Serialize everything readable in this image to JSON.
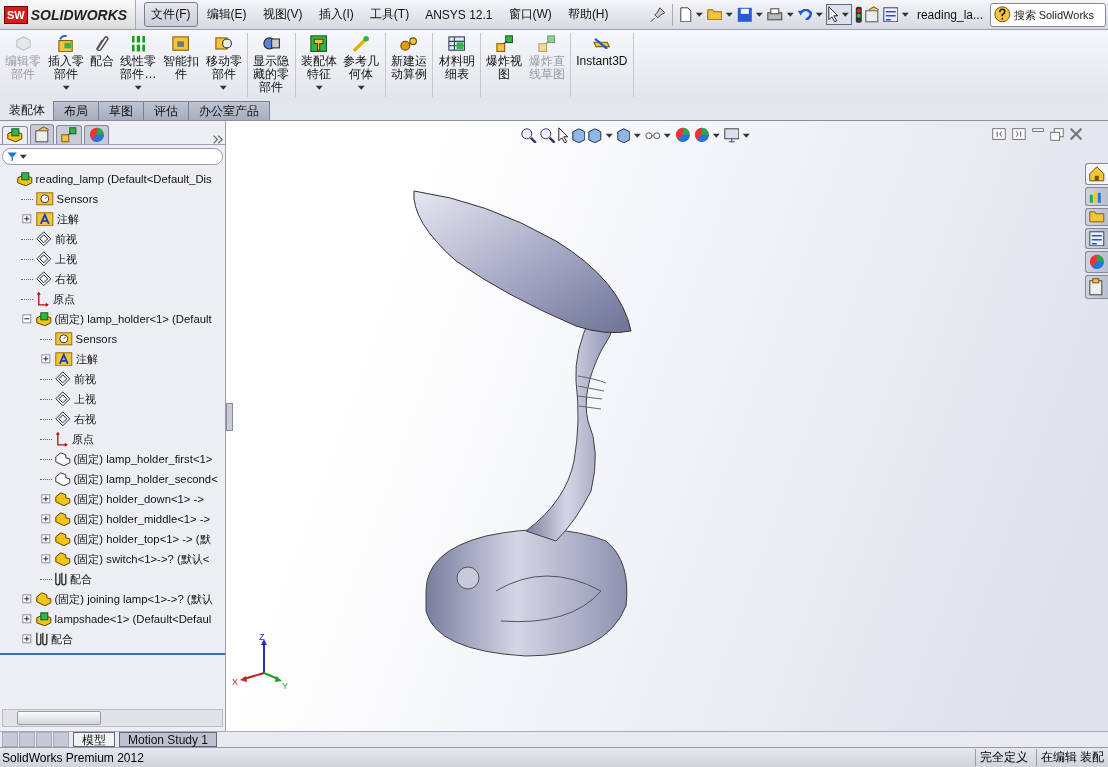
{
  "app": {
    "logo_mark": "SW",
    "logo_text": "SOLIDWORKS"
  },
  "menu": [
    {
      "label": "文件(F)",
      "selected": true
    },
    {
      "label": "编辑(E)",
      "selected": false
    },
    {
      "label": "视图(V)",
      "selected": false
    },
    {
      "label": "插入(I)",
      "selected": false
    },
    {
      "label": "工具(T)",
      "selected": false
    },
    {
      "label": "ANSYS 12.1",
      "selected": false
    },
    {
      "label": "窗口(W)",
      "selected": false
    },
    {
      "label": "帮助(H)",
      "selected": false
    }
  ],
  "document_name": "reading_la...",
  "search": {
    "placeholder": "搜索 SolidWorks"
  },
  "commands": [
    {
      "label": "编辑零部件",
      "disabled": true,
      "dropdown": false
    },
    {
      "label": "插入零部件",
      "disabled": false,
      "dropdown": true
    },
    {
      "label": "配合",
      "disabled": false,
      "dropdown": false
    },
    {
      "label": "线性零部件…",
      "disabled": false,
      "dropdown": true
    },
    {
      "label": "智能扣件",
      "disabled": false,
      "dropdown": false
    },
    {
      "label": "移动零部件",
      "disabled": false,
      "dropdown": true
    },
    {
      "label": "显示隐藏的零部件",
      "disabled": false,
      "dropdown": false
    },
    {
      "label": "装配体特征",
      "disabled": false,
      "dropdown": true
    },
    {
      "label": "参考几何体",
      "disabled": false,
      "dropdown": true
    },
    {
      "label": "新建运动算例",
      "disabled": false,
      "dropdown": false
    },
    {
      "label": "材料明细表",
      "disabled": false,
      "dropdown": false
    },
    {
      "label": "爆炸视图",
      "disabled": false,
      "dropdown": false
    },
    {
      "label": "爆炸直线草图",
      "disabled": true,
      "dropdown": false
    },
    {
      "label": "Instant3D",
      "disabled": false,
      "dropdown": false
    }
  ],
  "tabs": [
    {
      "label": "装配体",
      "selected": true
    },
    {
      "label": "布局",
      "selected": false
    },
    {
      "label": "草图",
      "selected": false
    },
    {
      "label": "评估",
      "selected": false
    },
    {
      "label": "办公室产品",
      "selected": false
    }
  ],
  "tree": [
    {
      "kind": "assembly",
      "label": "reading_lamp  (Default<Default_Dis",
      "children": [
        {
          "kind": "sensors",
          "label": "Sensors"
        },
        {
          "kind": "annotations",
          "label": "注解",
          "expanded": false
        },
        {
          "kind": "plane",
          "label": "前视"
        },
        {
          "kind": "plane",
          "label": "上视"
        },
        {
          "kind": "plane",
          "label": "右视"
        },
        {
          "kind": "origin",
          "label": "原点"
        },
        {
          "kind": "assembly",
          "label": "(固定) lamp_holder<1> (Default",
          "expanded": true,
          "children": [
            {
              "kind": "sensors",
              "label": "Sensors"
            },
            {
              "kind": "annotations",
              "label": "注解",
              "expanded": false
            },
            {
              "kind": "plane",
              "label": "前视"
            },
            {
              "kind": "plane",
              "label": "上视"
            },
            {
              "kind": "plane",
              "label": "右视"
            },
            {
              "kind": "origin",
              "label": "原点"
            },
            {
              "kind": "part-outline",
              "label": "(固定) lamp_holder_first<1>"
            },
            {
              "kind": "part-outline",
              "label": "(固定) lamp_holder_second<"
            },
            {
              "kind": "part",
              "label": "(固定) holder_down<1> ->",
              "expanded": false
            },
            {
              "kind": "part",
              "label": "(固定) holder_middle<1> ->",
              "expanded": false
            },
            {
              "kind": "part",
              "label": "(固定) holder_top<1> -> (默",
              "expanded": false
            },
            {
              "kind": "part",
              "label": "(固定) switch<1>->? (默认<",
              "expanded": false
            },
            {
              "kind": "mates",
              "label": "配合"
            }
          ]
        },
        {
          "kind": "part",
          "label": "(固定) joining lamp<1>->? (默认",
          "expanded": false
        },
        {
          "kind": "assembly",
          "label": "lampshade<1> (Default<Defaul",
          "expanded": false
        },
        {
          "kind": "mates",
          "label": "配合",
          "expanded": false
        }
      ]
    }
  ],
  "triad": {
    "x": "X",
    "y": "Y",
    "z": "Z"
  },
  "bottom_tabs": [
    {
      "label": "模型",
      "selected": true
    },
    {
      "label": "Motion Study 1",
      "selected": false
    }
  ],
  "status_bar": {
    "product": "SolidWorks Premium 2012",
    "definition": "完全定义",
    "mode": "在编辑 装配"
  }
}
